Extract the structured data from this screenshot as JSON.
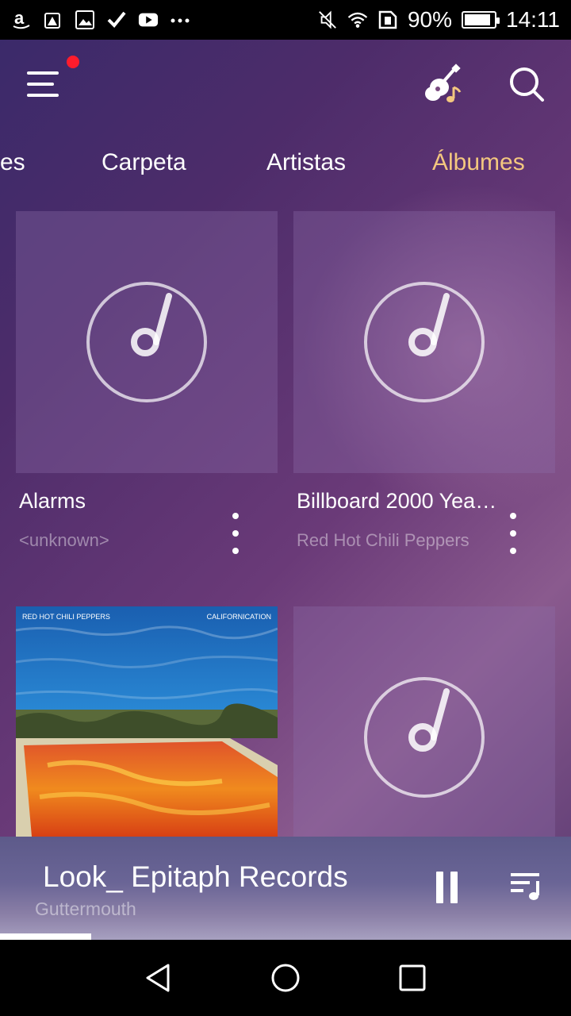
{
  "status_bar": {
    "battery": "90%",
    "battery_level": 0.9,
    "time": "14:11",
    "left_icons": [
      "amazon-icon",
      "warning-icon",
      "image-icon",
      "check-icon",
      "youtube-icon",
      "more-dots-icon"
    ],
    "right_icons": [
      "mute-icon",
      "wifi-icon",
      "sim-icon",
      "battery-icon"
    ]
  },
  "header": {
    "menu_icon": "menu-icon",
    "notification_color": "#ff1c2c",
    "guitar_icon": "guitar-icon",
    "search_icon": "search-icon"
  },
  "tabs": [
    {
      "label": "es",
      "active": false
    },
    {
      "label": "Carpeta",
      "active": false
    },
    {
      "label": "Artistas",
      "active": false
    },
    {
      "label": "Álbumes",
      "active": true
    }
  ],
  "accent_color": "#f3c77f",
  "albums": [
    {
      "title": "Alarms",
      "artist": "<unknown>",
      "cover": "placeholder"
    },
    {
      "title": "Billboard 2000 Yea…",
      "artist": "Red Hot Chili Peppers",
      "cover": "placeholder"
    },
    {
      "title": "",
      "artist": "",
      "cover": "photo",
      "cover_text_left": "RED HOT CHILI PEPPERS",
      "cover_text_right": "CALIFORNICATION"
    },
    {
      "title": "",
      "artist": "",
      "cover": "placeholder"
    }
  ],
  "now_playing": {
    "title": "Look_ Epitaph Records",
    "artist": "Guttermouth",
    "progress": 0.16
  },
  "nav_bar": [
    "back-icon",
    "home-icon",
    "recents-icon"
  ]
}
